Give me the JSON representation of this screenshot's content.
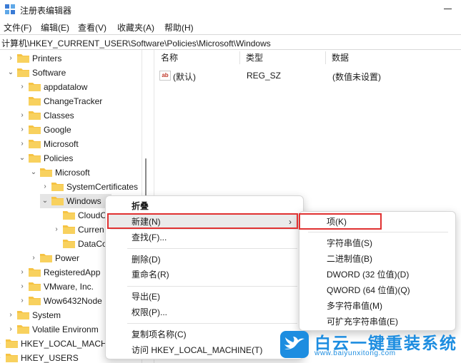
{
  "window": {
    "title": "注册表编辑器"
  },
  "menu": [
    "文件(F)",
    "编辑(E)",
    "查看(V)",
    "收藏夹(A)",
    "帮助(H)"
  ],
  "address": "计算机\\HKEY_CURRENT_USER\\Software\\Policies\\Microsoft\\Windows",
  "tree": [
    {
      "label": "Printers",
      "chev": "›"
    },
    {
      "label": "Software",
      "chev": "⌄"
    },
    {
      "label": "appdatalow",
      "chev": "›"
    },
    {
      "label": "ChangeTracker",
      "chev": ""
    },
    {
      "label": "Classes",
      "chev": "›"
    },
    {
      "label": "Google",
      "chev": "›"
    },
    {
      "label": "Microsoft",
      "chev": "›"
    },
    {
      "label": "Policies",
      "chev": "⌄"
    },
    {
      "label": "Microsoft",
      "chev": "⌄"
    },
    {
      "label": "SystemCertificates",
      "chev": "›"
    },
    {
      "label": "Windows",
      "chev": "⌄"
    },
    {
      "label": "CloudC",
      "chev": ""
    },
    {
      "label": "Curren",
      "chev": "›"
    },
    {
      "label": "DataCo",
      "chev": ""
    },
    {
      "label": "Power",
      "chev": "›"
    },
    {
      "label": "RegisteredApp",
      "chev": "›"
    },
    {
      "label": "VMware, Inc.",
      "chev": "›"
    },
    {
      "label": "Wow6432Node",
      "chev": "›"
    },
    {
      "label": "System",
      "chev": "›"
    },
    {
      "label": "Volatile Environm",
      "chev": "›"
    },
    {
      "label": "HKEY_LOCAL_MACH",
      "chev": "›"
    },
    {
      "label": "HKEY_USERS",
      "chev": "›"
    }
  ],
  "list": {
    "columns": [
      "名称",
      "类型",
      "数据"
    ],
    "rows": [
      {
        "name": "(默认)",
        "type": "REG_SZ",
        "data": "(数值未设置)",
        "icon": "ab"
      }
    ]
  },
  "context_menu": {
    "items": [
      "折叠",
      "新建(N)",
      "查找(F)...",
      "删除(D)",
      "重命名(R)",
      "导出(E)",
      "权限(P)...",
      "复制项名称(C)",
      "访问 HKEY_LOCAL_MACHINE(T)"
    ],
    "submenu_arrow": "›"
  },
  "submenu": {
    "items": [
      "项(K)",
      "字符串值(S)",
      "二进制值(B)",
      "DWORD (32 位值)(D)",
      "QWORD (64 位值)(Q)",
      "多字符串值(M)",
      "可扩充字符串值(E)"
    ]
  },
  "watermark": {
    "title": "白云一键重装系统",
    "url": "www.baiyunxitong.com"
  },
  "colors": {
    "accent": "#1d8de0",
    "highlight": "#e03131",
    "folder": "#f6c343"
  }
}
